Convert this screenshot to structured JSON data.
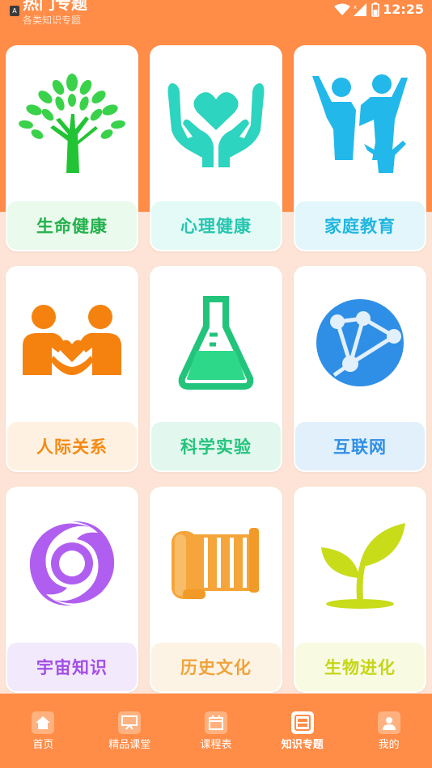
{
  "header": {
    "title": "热门专题",
    "subtitle": "各类知识专题"
  },
  "status_bar": {
    "app_badge": "A",
    "time": "12:25"
  },
  "cards": [
    {
      "label": "生命健康",
      "icon": "tree-icon",
      "label_color": "#22b14c",
      "label_bg": "#eafaec"
    },
    {
      "label": "心理健康",
      "icon": "heart-hands-icon",
      "label_color": "#26c6b0",
      "label_bg": "#e3faf6"
    },
    {
      "label": "家庭教育",
      "icon": "family-icon",
      "label_color": "#1fb6e0",
      "label_bg": "#e2f6fb"
    },
    {
      "label": "人际关系",
      "icon": "people-heart-icon",
      "label_color": "#f58a12",
      "label_bg": "#fff1e2"
    },
    {
      "label": "科学实验",
      "icon": "flask-icon",
      "label_color": "#22c47c",
      "label_bg": "#e2f8ee"
    },
    {
      "label": "互联网",
      "icon": "network-globe-icon",
      "label_color": "#2f8fe6",
      "label_bg": "#e2f0fc"
    },
    {
      "label": "宇宙知识",
      "icon": "galaxy-icon",
      "label_color": "#a24ee6",
      "label_bg": "#f3e9fc"
    },
    {
      "label": "历史文化",
      "icon": "scroll-icon",
      "label_color": "#f0a23a",
      "label_bg": "#fdf3e4"
    },
    {
      "label": "生物进化",
      "icon": "sprout-icon",
      "label_color": "#c6d616",
      "label_bg": "#f8fbe2"
    }
  ],
  "tabs": [
    {
      "label": "首页",
      "icon": "home-icon",
      "active": false
    },
    {
      "label": "精品课堂",
      "icon": "classroom-icon",
      "active": false
    },
    {
      "label": "课程表",
      "icon": "calendar-icon",
      "active": false
    },
    {
      "label": "知识专题",
      "icon": "topics-icon",
      "active": true
    },
    {
      "label": "我的",
      "icon": "profile-icon",
      "active": false
    }
  ],
  "colors": {
    "accent": "#ff8c47",
    "page_bg": "#fde4d6"
  }
}
